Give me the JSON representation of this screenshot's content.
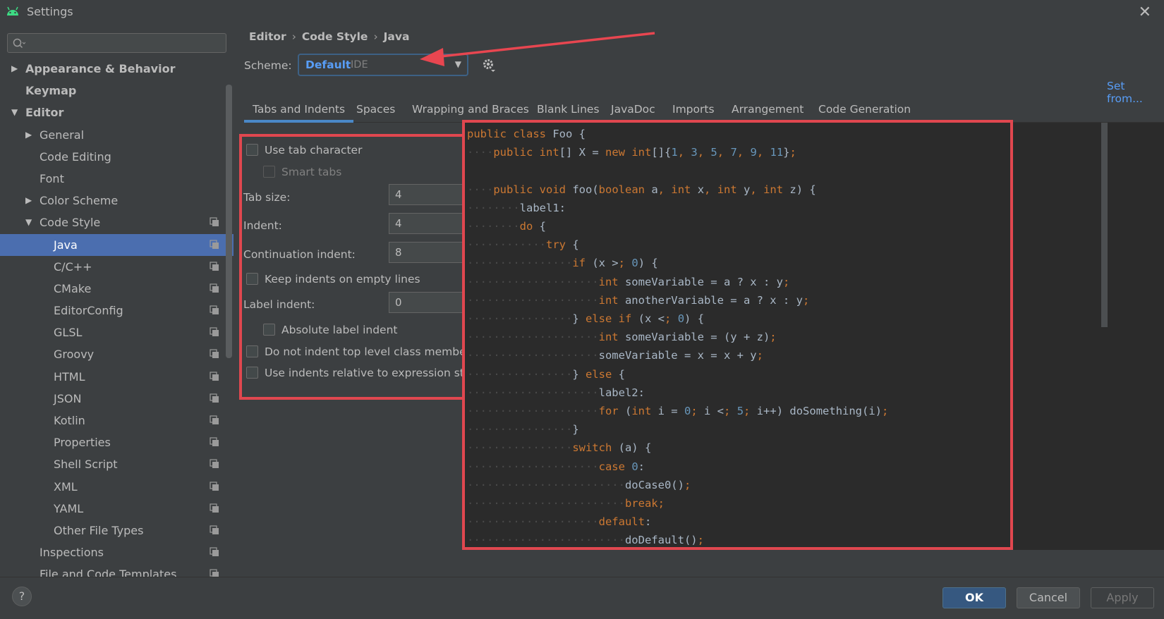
{
  "window": {
    "title": "Settings",
    "close_icon": "close-icon"
  },
  "colors": {
    "accent": "#4b6eaf",
    "highlight_box": "#e0474f",
    "link": "#589df6",
    "keyword": "#cc7832",
    "number": "#6897bb"
  },
  "sidebar": {
    "search": {
      "placeholder": "",
      "value": ""
    },
    "items": [
      {
        "label": "Appearance & Behavior",
        "level": 0,
        "arrow": "▶",
        "bold": true
      },
      {
        "label": "Keymap",
        "level": 0,
        "arrow": "",
        "bold": true
      },
      {
        "label": "Editor",
        "level": 0,
        "arrow": "▼",
        "bold": true
      },
      {
        "label": "General",
        "level": 1,
        "arrow": "▶"
      },
      {
        "label": "Code Editing",
        "level": 1,
        "arrow": ""
      },
      {
        "label": "Font",
        "level": 1,
        "arrow": ""
      },
      {
        "label": "Color Scheme",
        "level": 1,
        "arrow": "▶"
      },
      {
        "label": "Code Style",
        "level": 1,
        "arrow": "▼",
        "copy": true
      },
      {
        "label": "Java",
        "level": 2,
        "arrow": "",
        "copy": true,
        "selected": true
      },
      {
        "label": "C/C++",
        "level": 2,
        "arrow": "",
        "copy": true
      },
      {
        "label": "CMake",
        "level": 2,
        "arrow": "",
        "copy": true
      },
      {
        "label": "EditorConfig",
        "level": 2,
        "arrow": "",
        "copy": true
      },
      {
        "label": "GLSL",
        "level": 2,
        "arrow": "",
        "copy": true
      },
      {
        "label": "Groovy",
        "level": 2,
        "arrow": "",
        "copy": true
      },
      {
        "label": "HTML",
        "level": 2,
        "arrow": "",
        "copy": true
      },
      {
        "label": "JSON",
        "level": 2,
        "arrow": "",
        "copy": true
      },
      {
        "label": "Kotlin",
        "level": 2,
        "arrow": "",
        "copy": true
      },
      {
        "label": "Properties",
        "level": 2,
        "arrow": "",
        "copy": true
      },
      {
        "label": "Shell Script",
        "level": 2,
        "arrow": "",
        "copy": true
      },
      {
        "label": "XML",
        "level": 2,
        "arrow": "",
        "copy": true
      },
      {
        "label": "YAML",
        "level": 2,
        "arrow": "",
        "copy": true
      },
      {
        "label": "Other File Types",
        "level": 2,
        "arrow": "",
        "copy": true
      },
      {
        "label": "Inspections",
        "level": 1,
        "arrow": "",
        "copy": true
      },
      {
        "label": "File and Code Templates",
        "level": 1,
        "arrow": "",
        "copy": true
      }
    ]
  },
  "breadcrumb": {
    "part1": "Editor",
    "part2": "Code Style",
    "part3": "Java",
    "sep": "›"
  },
  "scheme": {
    "label": "Scheme:",
    "value": "Default",
    "sub": "IDE"
  },
  "set_from": "Set from...",
  "tabs": [
    "Tabs and Indents",
    "Spaces",
    "Wrapping and Braces",
    "Blank Lines",
    "JavaDoc",
    "Imports",
    "Arrangement",
    "Code Generation"
  ],
  "options": {
    "use_tab": "Use tab character",
    "smart_tabs": "Smart tabs",
    "tab_size_label": "Tab size:",
    "tab_size": "4",
    "indent_label": "Indent:",
    "indent": "4",
    "cont_indent_label": "Continuation indent:",
    "cont_indent": "8",
    "keep_indents": "Keep indents on empty lines",
    "label_indent_label": "Label indent:",
    "label_indent": "0",
    "absolute_label": "Absolute label indent",
    "no_indent_top": "Do not indent top level class members",
    "relative_expr": "Use indents relative to expression start"
  },
  "code_lines": [
    "public class Foo {",
    "    public int[] X = new int[]{1, 3, 5, 7, 9, 11};",
    "",
    "    public void foo(boolean a, int x, int y, int z) {",
    "        label1:",
    "        do {",
    "            try {",
    "                if (x > 0) {",
    "                    int someVariable = a ? x : y;",
    "                    int anotherVariable = a ? x : y;",
    "                } else if (x < 0) {",
    "                    int someVariable = (y + z);",
    "                    someVariable = x = x + y;",
    "                } else {",
    "                    label2:",
    "                    for (int i = 0; i < 5; i++) doSomething(i);",
    "                }",
    "                switch (a) {",
    "                    case 0:",
    "                        doCase0();",
    "                        break;",
    "                    default:",
    "                        doDefault();"
  ],
  "buttons": {
    "help": "?",
    "ok": "OK",
    "cancel": "Cancel",
    "apply": "Apply"
  }
}
